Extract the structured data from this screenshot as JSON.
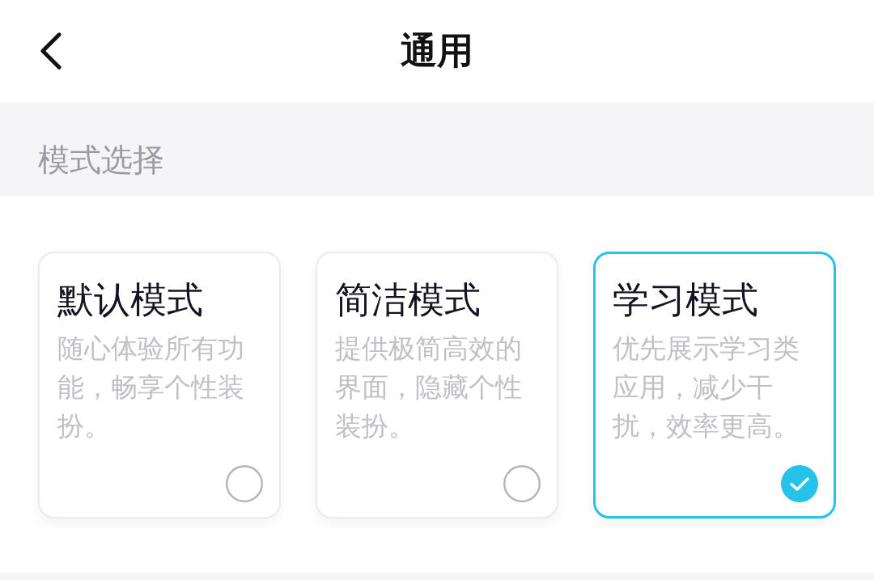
{
  "header": {
    "title": "通用"
  },
  "section": {
    "label": "模式选择"
  },
  "modes": [
    {
      "title": "默认模式",
      "description": "随心体验所有功能，畅享个性装扮。",
      "selected": false
    },
    {
      "title": "简洁模式",
      "description": "提供极简高效的界面，隐藏个性装扮。",
      "selected": false
    },
    {
      "title": "学习模式",
      "description": "优先展示学习类应用，减少干扰，效率更高。",
      "selected": true
    }
  ]
}
